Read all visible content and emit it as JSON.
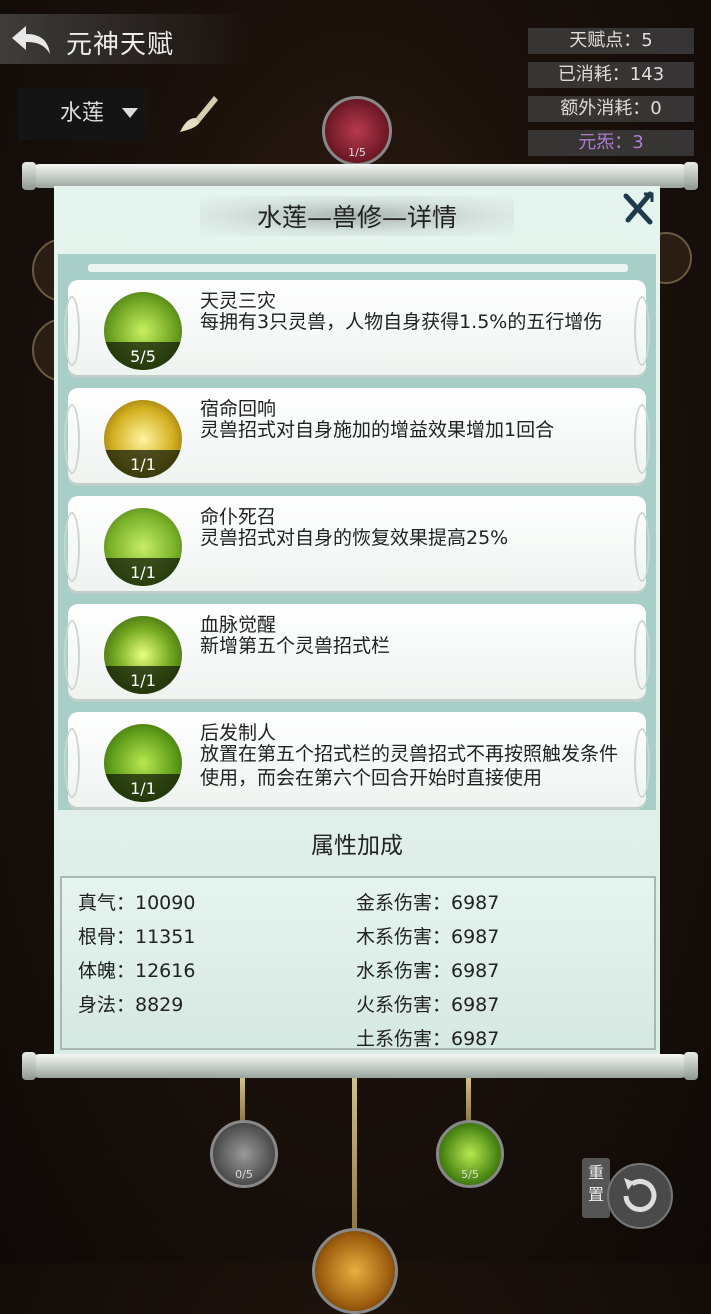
{
  "header": {
    "title": "元神天赋",
    "element_select": "水莲"
  },
  "stats": [
    {
      "label": "天赋点：5"
    },
    {
      "label": "已消耗：143"
    },
    {
      "label": "额外消耗：0"
    },
    {
      "label": "元炁：3"
    }
  ],
  "top_node": {
    "progress": "1/5"
  },
  "panel": {
    "title": "水莲—兽修—详情",
    "skills": [
      {
        "name": "天灵三灾",
        "desc": "每拥有3只灵兽，人物自身获得1.5%的五行增伤",
        "level": "5/5"
      },
      {
        "name": "宿命回响",
        "desc": "灵兽招式对自身施加的增益效果增加1回合",
        "level": "1/1"
      },
      {
        "name": "命仆死召",
        "desc": "灵兽招式对自身的恢复效果提高25%",
        "level": "1/1"
      },
      {
        "name": "血脉觉醒",
        "desc": "新增第五个灵兽招式栏",
        "level": "1/1"
      },
      {
        "name": "后发制人",
        "desc": "放置在第五个招式栏的灵兽招式不再按照触发条件使用，而会在第六个回合开始时直接使用",
        "level": "1/1"
      }
    ],
    "attr_title": "属性加成",
    "attrs_left": [
      "真气：10090",
      "根骨：11351",
      "体魄：12616",
      "身法：8829"
    ],
    "attrs_right": [
      "金系伤害：6987",
      "木系伤害：6987",
      "水系伤害：6987",
      "火系伤害：6987",
      "土系伤害：6987"
    ]
  },
  "bottom_nodes": [
    {
      "progress": "0/5"
    },
    {
      "progress": "5/5"
    }
  ],
  "reset_label": "重置",
  "colors": {
    "accent_purple": "#b07cd0",
    "panel_bg": "#e6f4ef",
    "list_frame": "#a7cfc7"
  }
}
